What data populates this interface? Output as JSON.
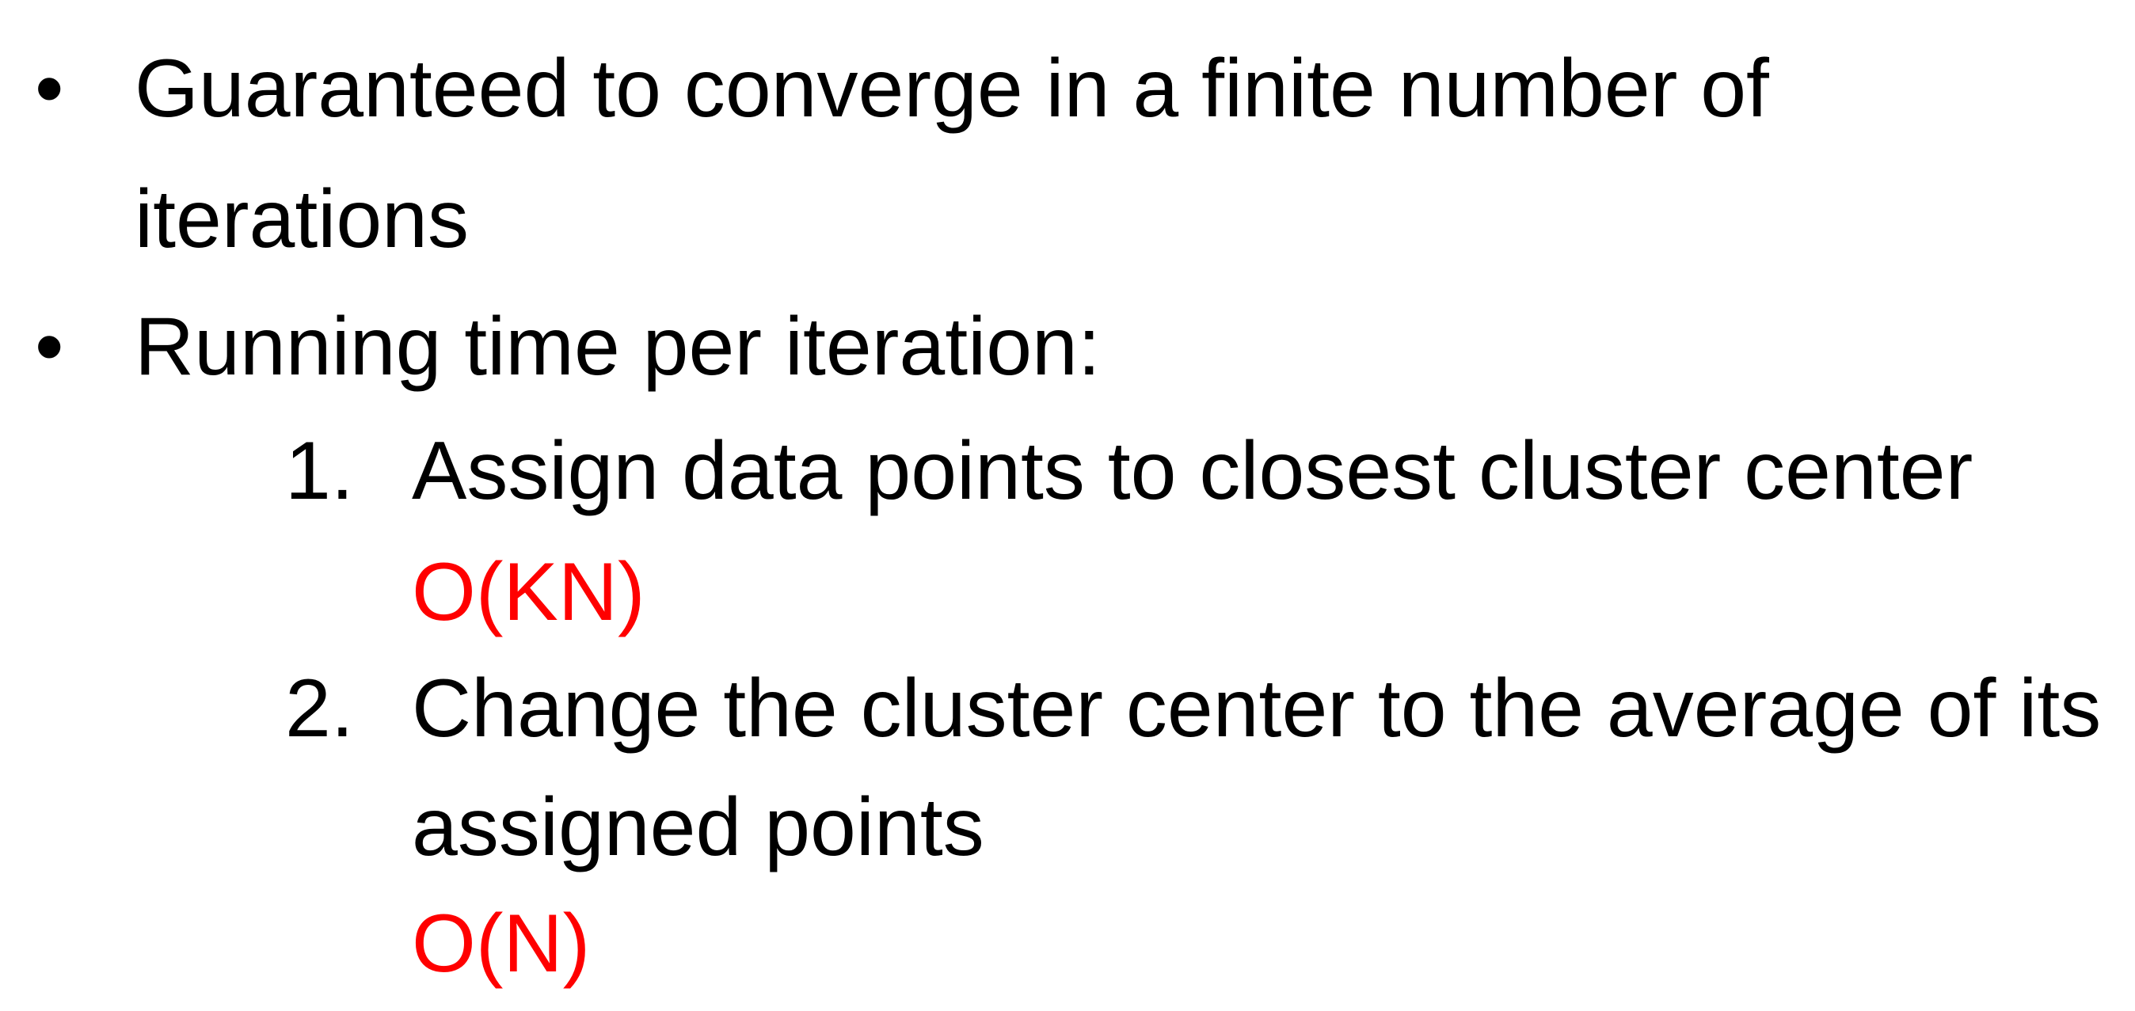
{
  "slide": {
    "bullets": [
      {
        "marker": "•",
        "lines": [
          "Guaranteed to converge in a finite number of",
          "iterations"
        ]
      },
      {
        "marker": "•",
        "lines": [
          "Running time per iteration:"
        ]
      }
    ],
    "steps": [
      {
        "marker": "1.",
        "lines": [
          "Assign data points to closest cluster center"
        ],
        "complexity": "O(KN)"
      },
      {
        "marker": "2.",
        "lines": [
          "Change the cluster center to the average of its",
          "assigned points"
        ],
        "complexity": "O(N)"
      }
    ],
    "colors": {
      "text": "#000000",
      "complexity": "#ff0000",
      "background": "#ffffff"
    }
  }
}
